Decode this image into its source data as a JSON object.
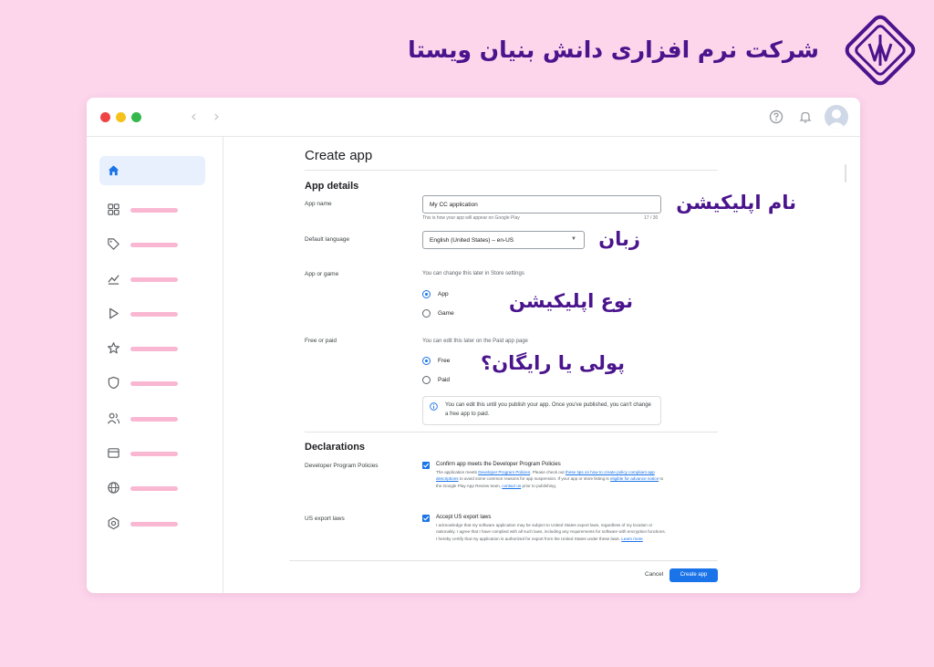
{
  "brand": {
    "title": "شرکت نرم افزاری دانش بنیان ویستا",
    "logo_icon": "vista-diamond-logo",
    "color": "#4a148c"
  },
  "window": {
    "back_icon": "‹",
    "forward_icon": "›"
  },
  "page": {
    "title": "Create app",
    "app_details": {
      "heading": "App details",
      "app_name": {
        "label": "App name",
        "value": "My CC application",
        "helper": "This is how your app will appear on Google Play",
        "counter": "17 / 30"
      },
      "default_language": {
        "label": "Default language",
        "value": "English (United States) – en-US"
      },
      "app_or_game": {
        "label": "App or game",
        "note": "You can change this later in Store settings",
        "options": [
          "App",
          "Game"
        ],
        "selected": "App"
      },
      "free_or_paid": {
        "label": "Free or paid",
        "note": "You can edit this later on the Paid app page",
        "options": [
          "Free",
          "Paid"
        ],
        "selected": "Free"
      },
      "info": "You can edit this until you publish your app. Once you've published, you can't change a free app to paid."
    },
    "declarations": {
      "heading": "Declarations",
      "policies": {
        "label": "Developer Program Policies",
        "checkbox_title": "Confirm app meets the Developer Program Policies",
        "t1": "The application meets ",
        "l1": "Developer Program Policies",
        "t2": ". Please check out ",
        "l2": "these tips on how to create policy compliant app descriptions",
        "t3": " to avoid some common reasons for app suspension. If your app or store listing is ",
        "l3": "eligible for advance notice",
        "t4": " to the Google Play App Review team, ",
        "l4": "contact us",
        "t5": " prior to publishing."
      },
      "export": {
        "label": "US export laws",
        "checkbox_title": "Accept US export laws",
        "body": "I acknowledge that my software application may be subject to United States export laws, regardless of my location or nationality. I agree that I have complied with all such laws, including any requirements for software with encryption functions. I hereby certify that my application is authorized for export from the United States under these laws. ",
        "link": "Learn more"
      }
    },
    "cancel_label": "Cancel",
    "create_label": "Create app"
  },
  "annotations": {
    "app_name": "نام اپلیکیشن",
    "language": "زبان",
    "app_type": "نوع اپلیکیشن",
    "pricing": "پولی یا رایگان؟"
  },
  "sidebar_icons": [
    "home-icon",
    "apps-grid-icon",
    "tag-icon",
    "stats-icon",
    "play-icon",
    "star-icon",
    "shield-icon",
    "users-icon",
    "card-icon",
    "globe-icon",
    "settings-icon"
  ],
  "colors": {
    "accent": "#1a73e8",
    "background": "#fdd6ec",
    "sidebar_placeholder": "#f9b7d2"
  }
}
